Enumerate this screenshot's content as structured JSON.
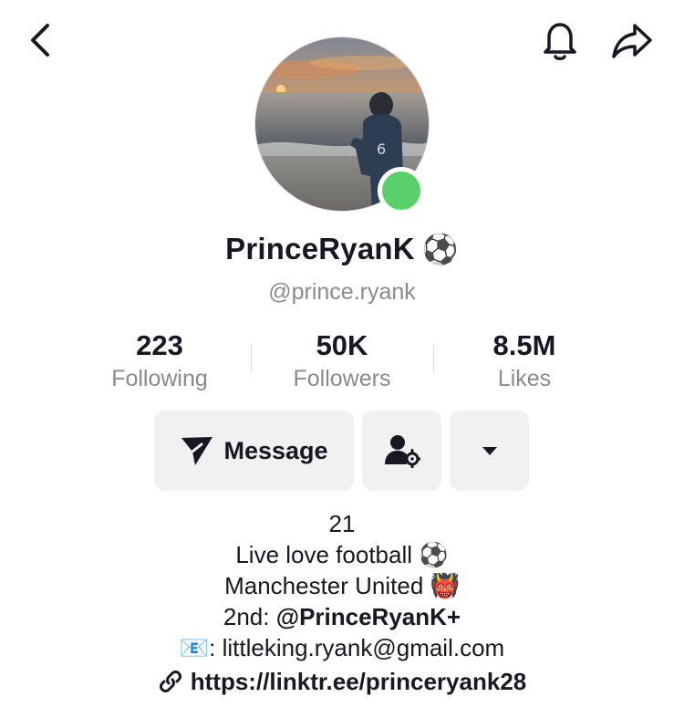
{
  "header": {
    "back_icon": "chevron-left-icon",
    "bell_icon": "bell-icon",
    "share_icon": "share-arrow-icon"
  },
  "profile": {
    "display_name": "PrinceRyanK",
    "display_name_emoji": "⚽",
    "username": "@prince.ryank",
    "online_status_color": "#5ad06a"
  },
  "stats": {
    "following": {
      "value": "223",
      "label": "Following"
    },
    "followers": {
      "value": "50K",
      "label": "Followers"
    },
    "likes": {
      "value": "8.5M",
      "label": "Likes"
    }
  },
  "actions": {
    "message_label": "Message",
    "message_icon": "send-icon",
    "friend_icon": "user-settings-icon",
    "more_icon": "caret-down-icon"
  },
  "bio": {
    "line1": "21",
    "line2_text": "Live love football",
    "line2_emoji": "⚽",
    "line3_text": "Manchester United",
    "line3_emoji": "👹",
    "line4_prefix": "2nd: ",
    "line4_handle": "@PrinceRyanK+",
    "line5_emoji": "📧",
    "line5_text": ": littleking.ryank@gmail.com",
    "link": "https://linktr.ee/princeryank28"
  }
}
